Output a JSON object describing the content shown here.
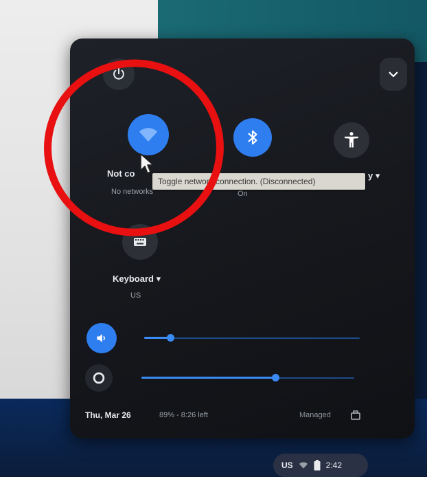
{
  "quick_settings": {
    "network": {
      "title": "Not co",
      "subtitle": "No networks",
      "tooltip": "Toggle network connection. (Disconnected)"
    },
    "bluetooth": {
      "subtitle": "On"
    },
    "accessibility": {
      "title_partial": "y ▾"
    },
    "keyboard": {
      "title": "Keyboard ▾",
      "subtitle": "US"
    },
    "volume": {
      "level": 0.12
    },
    "brightness": {
      "level": 0.63
    },
    "footer": {
      "date": "Thu, Mar 26",
      "battery": "89% - 8:26 left",
      "managed": "Managed"
    }
  },
  "tray": {
    "input": "US",
    "time": "2:42"
  },
  "colors": {
    "accent": "#2f7ef0",
    "annotation": "#e81010"
  },
  "icons": [
    "power-icon",
    "chevron-down-icon",
    "wifi-icon",
    "bluetooth-icon",
    "accessibility-icon",
    "keyboard-icon",
    "volume-icon",
    "brightness-icon",
    "managed-icon",
    "cursor-icon"
  ]
}
